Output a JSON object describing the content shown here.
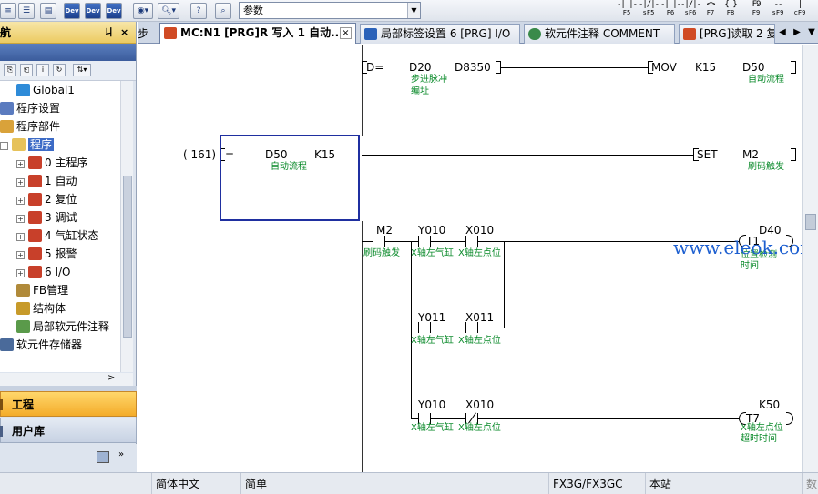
{
  "toolbar": {
    "combo_value": "参数",
    "fkeys": [
      {
        "sym": "-| |-",
        "label": "F5"
      },
      {
        "sym": "-|/|-",
        "label": "sF5"
      },
      {
        "sym": "-| |-",
        "label": "F6"
      },
      {
        "sym": "-|/|-",
        "label": "sF6"
      },
      {
        "sym": "<>",
        "label": "F7"
      },
      {
        "sym": "{ }",
        "label": "F8"
      },
      {
        "sym": "F9",
        "label": "F9"
      },
      {
        "sym": "--",
        "label": "sF9"
      },
      {
        "sym": "|",
        "label": "cF9"
      }
    ]
  },
  "sidebar": {
    "title": "导航",
    "pin": "ㄐ",
    "close": "×",
    "sub_title": "",
    "tree": [
      {
        "label": "Global1",
        "indent": 1,
        "icon": "globe-icon"
      },
      {
        "label": "程序设置",
        "indent": 0,
        "icon": "settings-icon"
      },
      {
        "label": "程序部件",
        "indent": 0,
        "icon": "parts-icon"
      },
      {
        "label": "程序",
        "indent": 0,
        "icon": "folder-icon",
        "expander": "−",
        "selected": true
      },
      {
        "label": "0 主程序",
        "indent": 1,
        "icon": "program-icon",
        "expander": "+"
      },
      {
        "label": "1 自动",
        "indent": 1,
        "icon": "program-icon",
        "expander": "+"
      },
      {
        "label": "2 复位",
        "indent": 1,
        "icon": "program-icon",
        "expander": "+"
      },
      {
        "label": "3 调试",
        "indent": 1,
        "icon": "program-icon",
        "expander": "+"
      },
      {
        "label": "4 气缸状态",
        "indent": 1,
        "icon": "program-icon",
        "expander": "+"
      },
      {
        "label": "5 报警",
        "indent": 1,
        "icon": "program-icon",
        "expander": "+"
      },
      {
        "label": "6 I/O",
        "indent": 1,
        "icon": "program-icon",
        "expander": "+"
      },
      {
        "label": "FB管理",
        "indent": 1,
        "icon": "fb-icon"
      },
      {
        "label": "结构体",
        "indent": 1,
        "icon": "struct-icon"
      },
      {
        "label": "局部软元件注释",
        "indent": 1,
        "icon": "comment-icon"
      },
      {
        "label": "软元件存储器",
        "indent": 0,
        "icon": "memory-icon"
      }
    ],
    "hscroll_arrow": ">",
    "panels": {
      "project": "工程",
      "user_lib": "用户库"
    }
  },
  "tabs": {
    "left_cut": "步",
    "items": [
      {
        "label": "MC:N1 [PRG]R 写入 1 自动...",
        "active": true,
        "close": "×"
      },
      {
        "label": "局部标签设置 6 [PRG] I/O"
      },
      {
        "label": "软元件注释 COMMENT"
      },
      {
        "label": "[PRG]读取 2 复"
      }
    ],
    "nav": [
      "◀",
      "▶",
      "▼"
    ]
  },
  "ladder": {
    "rung1": {
      "instr": "D=",
      "op1": "D20",
      "op2": "D8350",
      "op1_comment_1": "步进脉冲",
      "op1_comment_2": "编址",
      "out_instr": "MOV",
      "out_src": "K15",
      "out_dst": "D50",
      "out_dst_comment": "自动流程"
    },
    "rung2": {
      "step": "( 161)",
      "instr": "=",
      "op1": "D50",
      "op2": "K15",
      "op1_comment": "自动流程",
      "out_instr": "SET",
      "out_dst": "M2",
      "out_dst_comment": "刷码触发"
    },
    "rung3": {
      "c1": "M2",
      "c1_comment": "刷码触发",
      "c2": "Y010",
      "c2_comment": "X轴左气缸",
      "c3": "X010",
      "c3_comment": "X轴左点位",
      "timer": "T1",
      "timer_k": "D40",
      "timer_comment_1": "位置检测",
      "timer_comment_2": "时间",
      "b2_c1": "Y011",
      "b2_c1_comment": "X轴左气缸",
      "b2_c2": "X011",
      "b2_c2_comment": "X轴左点位"
    },
    "rung4": {
      "c1": "Y010",
      "c1_comment": "X轴左气缸",
      "c2": "X010",
      "c2_comment": "X轴左点位",
      "timer": "T7",
      "timer_k": "K50",
      "timer_comment_1": "X轴左点位",
      "timer_comment_2": "超时时间"
    }
  },
  "watermark": "www.eleok.com",
  "status": {
    "lang": "简体中文",
    "mode": "简单",
    "cpu": "FX3G/FX3GC",
    "station": "本站",
    "extra": "数"
  }
}
